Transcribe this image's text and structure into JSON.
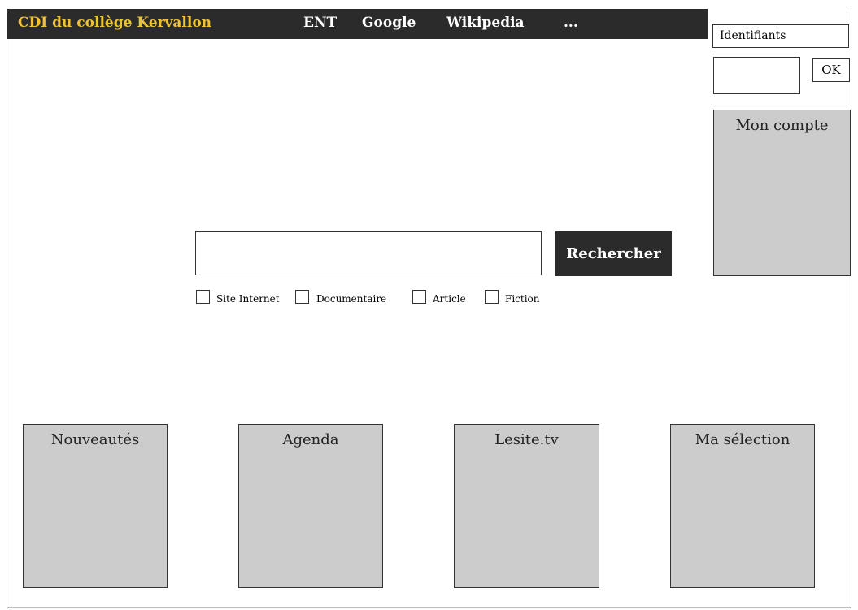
{
  "header": {
    "brand": "CDI du collège Kervallon",
    "links": [
      "ENT",
      "Google",
      "Wikipedia",
      "..."
    ]
  },
  "login": {
    "identifiants_label": "Identifiants",
    "ok_label": "OK"
  },
  "account_panel": {
    "title": "Mon compte"
  },
  "search": {
    "button_label": "Rechercher",
    "input_value": "",
    "filters": [
      "Site Internet",
      "Documentaire",
      "Article",
      "Fiction"
    ]
  },
  "bottom_panels": [
    "Nouveautés",
    "Agenda",
    "Lesite.tv",
    "Ma sélection"
  ],
  "colors": {
    "topbar": "#2b2b2b",
    "brand": "#f1c232",
    "panel": "#cccccc"
  }
}
